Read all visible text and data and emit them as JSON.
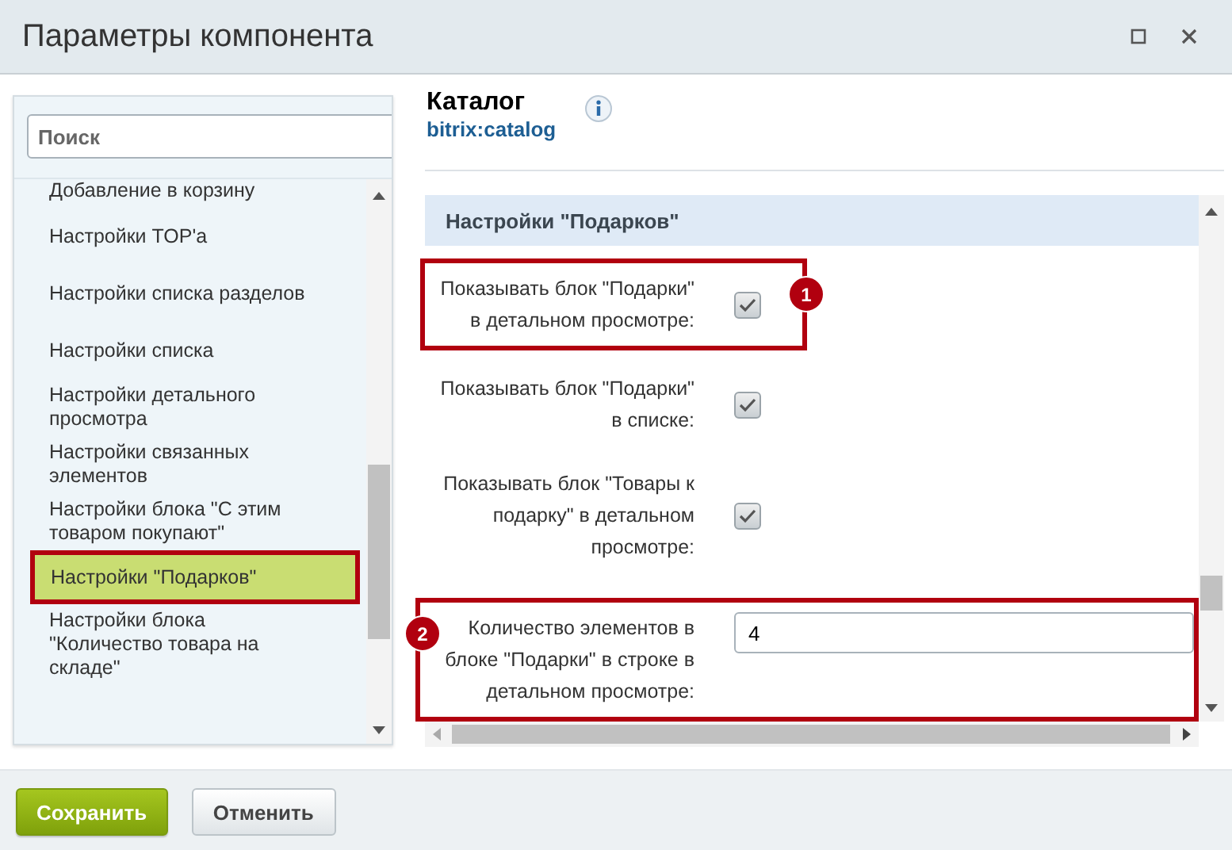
{
  "window": {
    "title": "Параметры компонента"
  },
  "sidebar": {
    "search": {
      "placeholder": "Поиск"
    },
    "items": [
      {
        "label": "Добавление в корзину",
        "selected": false
      },
      {
        "label": "Настройки TOP'а",
        "selected": false
      },
      {
        "label": "Настройки списка разделов",
        "selected": false
      },
      {
        "label": "Настройки списка",
        "selected": false
      },
      {
        "label": "Настройки детального просмотра",
        "selected": false
      },
      {
        "label": "Настройки связанных элементов",
        "selected": false
      },
      {
        "label": "Настройки блока \"С этим товаром покупают\"",
        "selected": false
      },
      {
        "label": "Настройки \"Подарков\"",
        "selected": true
      },
      {
        "label": "Настройки блока \"Количество товара на складе\"",
        "selected": false
      }
    ]
  },
  "component": {
    "name": "Каталог",
    "code": "bitrix:catalog"
  },
  "section": {
    "title": "Настройки \"Подарков\"",
    "rows": [
      {
        "kind": "checkbox",
        "label": "Показывать блок \"Подарки\" в детальном просмотре:",
        "checked": true,
        "callout": {
          "number": "1"
        }
      },
      {
        "kind": "checkbox",
        "label": "Показывать блок \"Подарки\" в списке:",
        "checked": true
      },
      {
        "kind": "checkbox",
        "label": "Показывать блок \"Товары к подарку\" в детальном просмотре:",
        "checked": true
      },
      {
        "kind": "number",
        "label": "Количество элементов в блоке \"Подарки\" в строке в детальном просмотре:",
        "value": "4",
        "callout": {
          "number": "2"
        }
      }
    ]
  },
  "buttons": [
    {
      "label": "Сохранить",
      "kind": "primary"
    },
    {
      "label": "Отменить",
      "kind": "secondary"
    }
  ]
}
